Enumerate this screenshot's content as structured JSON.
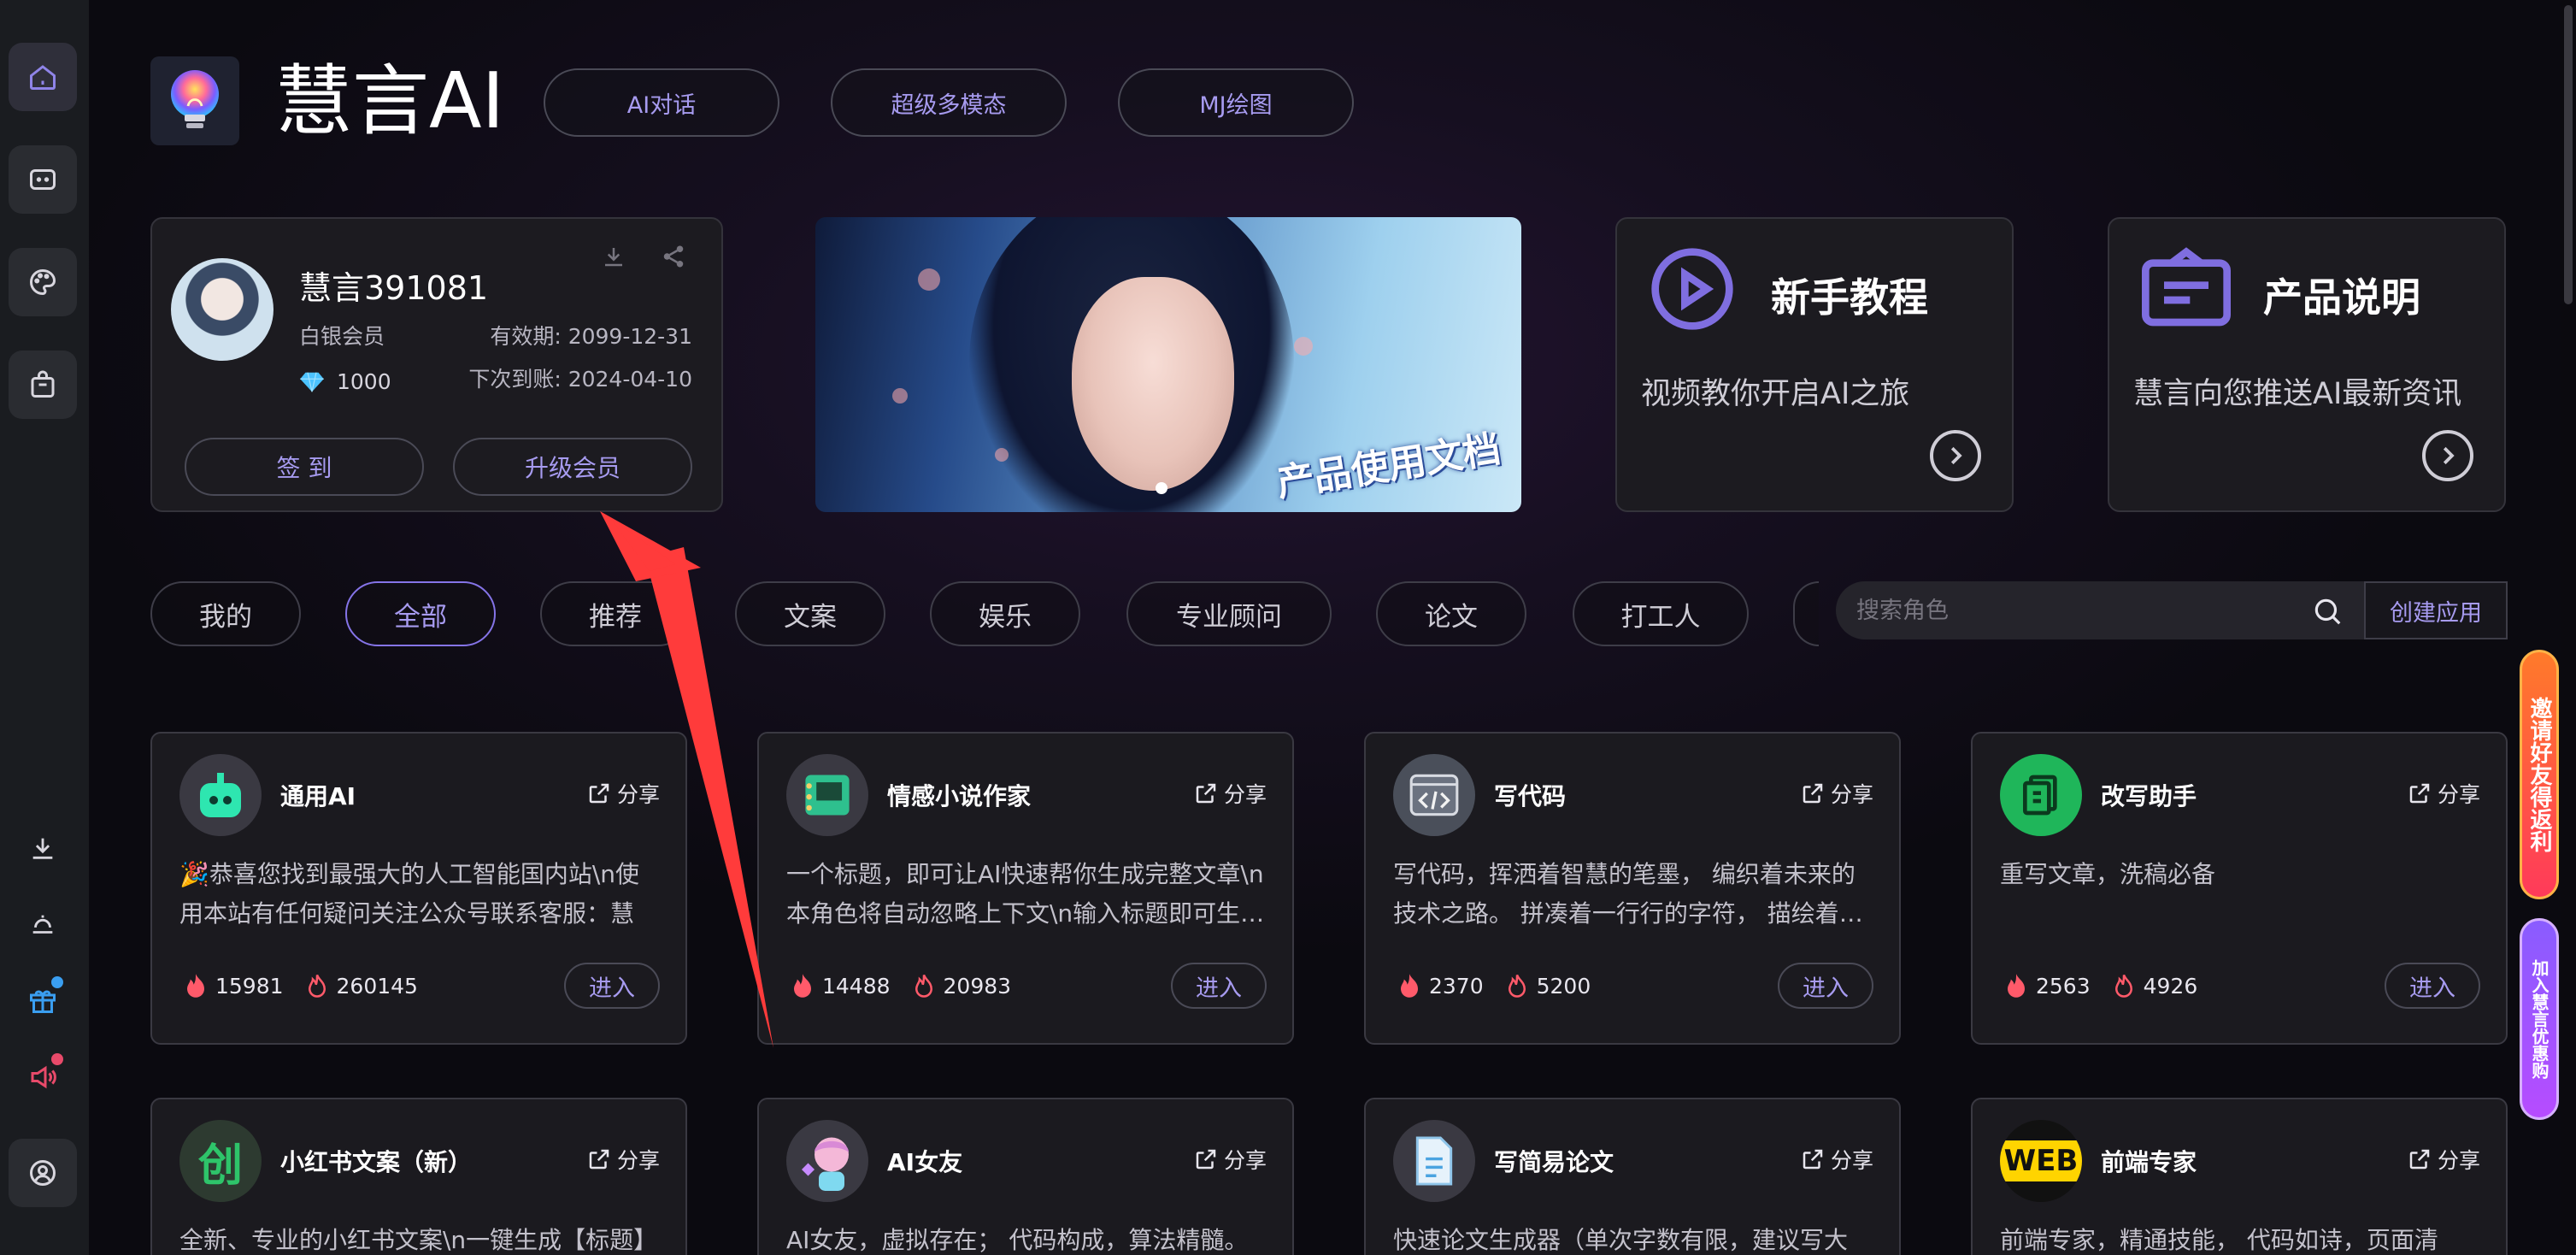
{
  "brand": {
    "title": "慧言AI"
  },
  "nav": [
    {
      "label": "AI对话"
    },
    {
      "label": "超级多模态"
    },
    {
      "label": "MJ绘图"
    }
  ],
  "profile": {
    "name": "慧言391081",
    "level": "白银会员",
    "valid_until": "有效期: 2099-12-31",
    "gems": "1000",
    "next_billing": "下次到账: 2024-04-10",
    "checkin_label": "签 到",
    "upgrade_label": "升级会员"
  },
  "banner": {
    "text": "产品使用文档"
  },
  "info_cards": [
    {
      "title": "新手教程",
      "subtitle": "视频教你开启AI之旅"
    },
    {
      "title": "产品说明",
      "subtitle": "慧言向您推送AI最新资讯"
    }
  ],
  "categories": [
    {
      "label": "我的"
    },
    {
      "label": "全部"
    },
    {
      "label": "推荐"
    },
    {
      "label": "文案"
    },
    {
      "label": "娱乐"
    },
    {
      "label": "专业顾问"
    },
    {
      "label": "论文"
    },
    {
      "label": "打工人"
    }
  ],
  "search": {
    "placeholder": "搜索角色"
  },
  "create_label": "创建应用",
  "share_label": "分享",
  "enter_label": "进入",
  "apps": [
    {
      "name": "通用AI",
      "desc": "🎉恭喜您找到最强大的人工智能国内站\\n使用本站有任何疑问关注公众号联系客服：慧言…",
      "hot": "15981",
      "uses": "260145"
    },
    {
      "name": "情感小说作家",
      "desc": "一个标题，即可让AI快速帮你生成完整文章\\n本角色将自动忽略上下文\\n输入标题即可生…",
      "hot": "14488",
      "uses": "20983"
    },
    {
      "name": "写代码",
      "desc": "写代码，挥洒着智慧的笔墨， 编织着未来的技术之路。 拼凑着一行行的字符， 描绘着…",
      "hot": "2370",
      "uses": "5200"
    },
    {
      "name": "改写助手",
      "desc": "重写文章，洗稿必备",
      "hot": "2563",
      "uses": "4926"
    },
    {
      "name": "小红书文案（新）",
      "desc": "全新、专业的小红书文案\\n一键生成【标题】",
      "hot": "",
      "uses": ""
    },
    {
      "name": "AI女友",
      "desc": "AI女友，虚拟存在； 代码构成，算法精髓。",
      "hot": "",
      "uses": ""
    },
    {
      "name": "写简易论文",
      "desc": "快速论文生成器（单次字数有限，建议写大",
      "hot": "",
      "uses": ""
    },
    {
      "name": "前端专家",
      "desc": "前端专家，精通技能， 代码如诗，页面清",
      "hot": "",
      "uses": ""
    }
  ],
  "float_banners": [
    {
      "text": "邀请好友得返利"
    },
    {
      "text": "加入慧言优惠购"
    }
  ],
  "icons": {
    "create_icon": "创",
    "web_icon": "WEB"
  },
  "colors": {
    "accent": "#a79bf0",
    "active_border": "#8574e8",
    "background": "#0d0b12",
    "card": "#1c1b20",
    "hot": "#ff5a6a"
  }
}
